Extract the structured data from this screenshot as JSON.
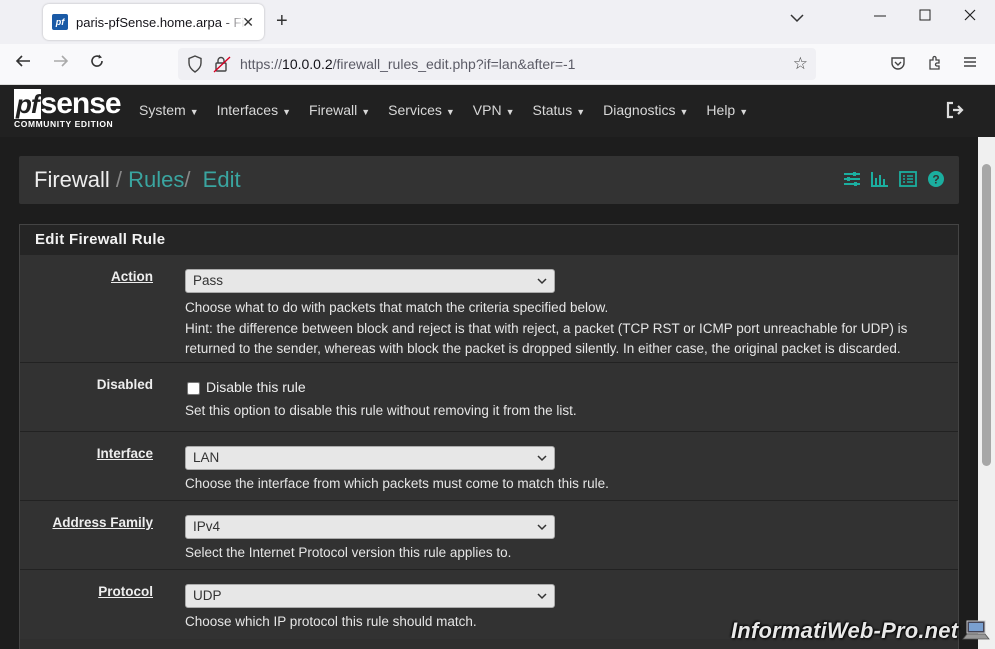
{
  "browser": {
    "tab_title": "paris-pfSense.home.arpa - Firewall: Rules: Edit",
    "tab_favicon_text": "pf",
    "new_tab_glyph": "+",
    "url_prefix": "https://",
    "url_host": "10.0.0.2",
    "url_path": "/firewall_rules_edit.php?if=lan&after=-1"
  },
  "pfsense": {
    "logo_pf": "pf",
    "logo_sense": "sense",
    "logo_subtitle": "COMMUNITY EDITION",
    "menu": [
      "System",
      "Interfaces",
      "Firewall",
      "Services",
      "VPN",
      "Status",
      "Diagnostics",
      "Help"
    ]
  },
  "breadcrumb": {
    "root": "Firewall",
    "sep1": "/",
    "level2": "Rules",
    "sep2": "/",
    "level3": "Edit"
  },
  "panel": {
    "title": "Edit Firewall Rule"
  },
  "form": {
    "action": {
      "label": "Action",
      "value": "Pass",
      "help1": "Choose what to do with packets that match the criteria specified below.",
      "help2": "Hint: the difference between block and reject is that with reject, a packet (TCP RST or ICMP port unreachable for UDP) is returned to the sender, whereas with block the packet is dropped silently. In either case, the original packet is discarded."
    },
    "disabled": {
      "label": "Disabled",
      "checkbox_label": "Disable this rule",
      "checked": false,
      "help": "Set this option to disable this rule without removing it from the list."
    },
    "interface": {
      "label": "Interface",
      "value": "LAN",
      "help": "Choose the interface from which packets must come to match this rule."
    },
    "address_family": {
      "label": "Address Family",
      "value": "IPv4",
      "help": "Select the Internet Protocol version this rule applies to."
    },
    "protocol": {
      "label": "Protocol",
      "value": "UDP",
      "help": "Choose which IP protocol this rule should match."
    }
  },
  "watermark": "InformatiWeb-Pro.net",
  "colors": {
    "accent_teal": "#1bae9f",
    "header_bg": "#212121",
    "panel_bg": "#323232"
  }
}
